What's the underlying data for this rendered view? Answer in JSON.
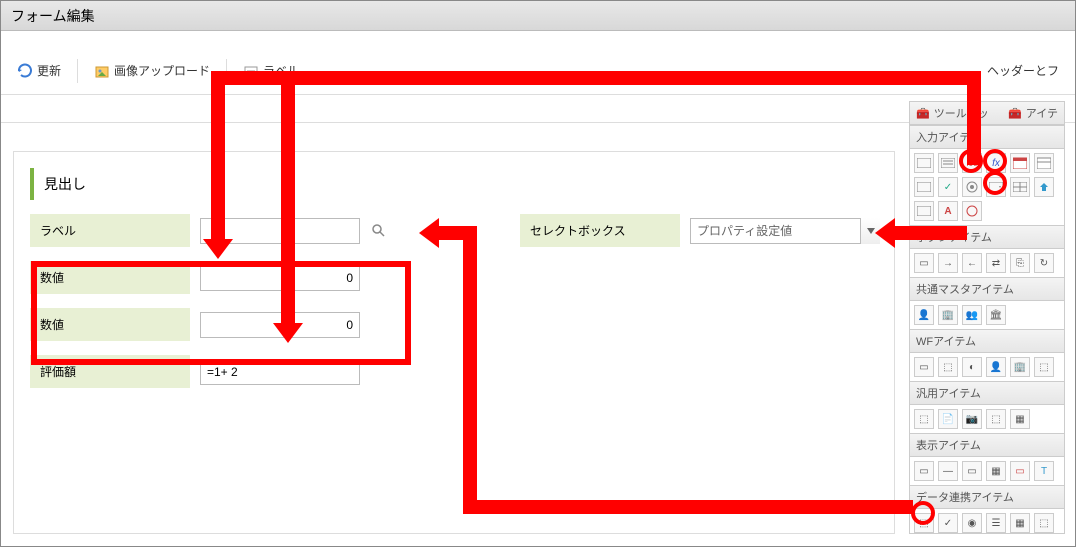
{
  "title": "フォーム編集",
  "toolbar": {
    "refresh": "更新",
    "upload": "画像アップロード",
    "label_tool": "ラベル",
    "header": "ヘッダーとフ"
  },
  "right_panel": {
    "toolkit": "ツールキッ",
    "items": "アイテ",
    "sections": {
      "input": "入力アイテム",
      "button": "ボタンアイテム",
      "master": "共通マスタアイテム",
      "wf": "WFアイテム",
      "generic": "汎用アイテム",
      "display": "表示アイテム",
      "link": "データ連携アイテム"
    },
    "icon_labels": {
      "number": ".00",
      "fx": "fx",
      "check": "✓",
      "text_a": "A"
    }
  },
  "form": {
    "heading": "見出し",
    "rows": [
      {
        "label": "ラベル",
        "value": "",
        "type": "text",
        "has_search": true
      },
      {
        "label": "数値",
        "value": "0",
        "type": "number"
      },
      {
        "label": "数値",
        "value": "0",
        "type": "number"
      },
      {
        "label": "評価額",
        "value": "=1+ 2",
        "type": "formula"
      }
    ],
    "select": {
      "label": "セレクトボックス",
      "placeholder": "プロパティ設定値"
    }
  }
}
